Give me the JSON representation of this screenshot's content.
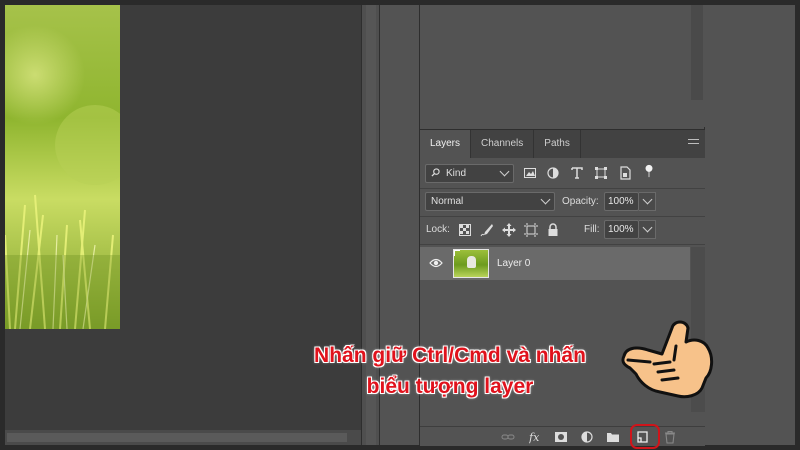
{
  "layers_panel": {
    "tabs": [
      {
        "label": "Layers",
        "active": true
      },
      {
        "label": "Channels",
        "active": false
      },
      {
        "label": "Paths",
        "active": false
      }
    ],
    "filter": {
      "kind_label": "Kind",
      "icons": [
        "pixel-filter-icon",
        "adjustment-filter-icon",
        "type-filter-icon",
        "shape-filter-icon",
        "smart-object-filter-icon",
        "filter-toggle-icon"
      ]
    },
    "blend_mode": "Normal",
    "opacity_label": "Opacity:",
    "opacity_value": "100%",
    "lock_label": "Lock:",
    "fill_label": "Fill:",
    "fill_value": "100%",
    "layers": [
      {
        "name": "Layer 0",
        "visible": true,
        "selected": true
      }
    ],
    "bottom_icons": [
      "link-icon",
      "fx-icon",
      "mask-icon",
      "adjustment-icon",
      "folder-icon",
      "new-layer-icon",
      "trash-icon"
    ]
  },
  "annotation": {
    "line1": "Nhấn giữ Ctrl/Cmd và nhấn",
    "line2": "biểu tượng layer",
    "color": "#e0121c"
  }
}
